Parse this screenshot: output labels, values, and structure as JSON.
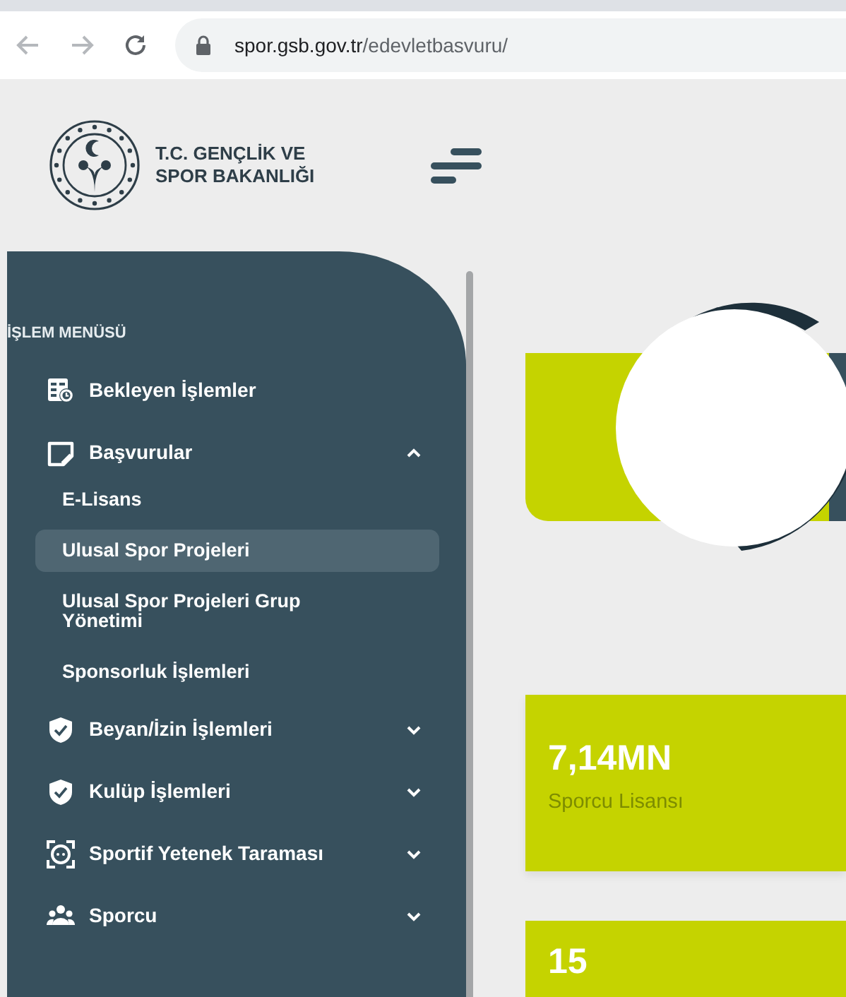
{
  "browser": {
    "url_host": "spor.gsb.gov.tr",
    "url_path": "/edevletbasvuru/"
  },
  "header": {
    "logo_lines": [
      "T.C. GENÇLİK VE",
      "SPOR BAKANLIĞI"
    ]
  },
  "sidebar": {
    "heading": "İŞLEM MENÜSÜ",
    "items": [
      {
        "kind": "link",
        "label": "Bekleyen İşlemler"
      },
      {
        "kind": "group",
        "label": "Başvurular",
        "expanded": true,
        "children": [
          {
            "label": "E-Lisans",
            "selected": false
          },
          {
            "label": "Ulusal Spor Projeleri",
            "selected": true
          },
          {
            "label": "Ulusal Spor Projeleri Grup Yönetimi",
            "selected": false
          },
          {
            "label": "Sponsorluk İşlemleri",
            "selected": false
          }
        ]
      },
      {
        "kind": "group",
        "label": "Beyan/İzin İşlemleri",
        "expanded": false
      },
      {
        "kind": "group",
        "label": "Kulüp İşlemleri",
        "expanded": false
      },
      {
        "kind": "group",
        "label": "Sportif Yetenek Taraması",
        "expanded": false
      },
      {
        "kind": "group",
        "label": "Sporcu",
        "expanded": false
      }
    ]
  },
  "stats": [
    {
      "value": "7,14MN",
      "label": "Sporcu Lisansı"
    },
    {
      "value": "15"
    }
  ]
}
